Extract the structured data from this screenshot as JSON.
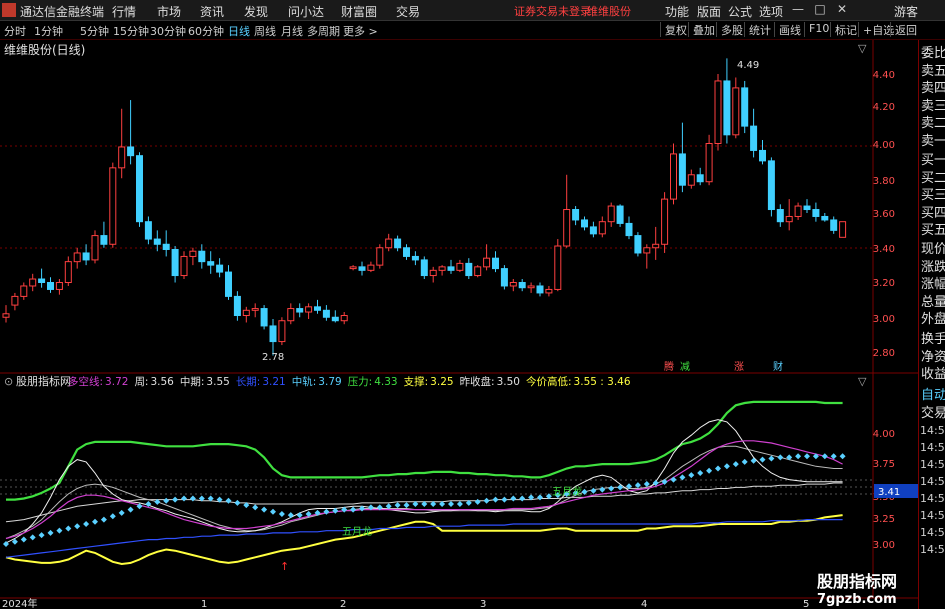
{
  "title_bar": {
    "app_name": "通达信金融终端",
    "menus": [
      "行情",
      "市场",
      "资讯",
      "发现",
      "问小达",
      "财富圈",
      "交易"
    ],
    "notice": "证券交易未登录",
    "stock_name": "维维股份",
    "right_menus": [
      "功能",
      "版面",
      "公式",
      "选项"
    ],
    "user": "游客",
    "window_controls": [
      "—",
      "□",
      "✕"
    ]
  },
  "period_bar": {
    "periods": [
      "分时",
      "1分钟",
      "5分钟",
      "15分钟",
      "30分钟",
      "60分钟",
      "日线",
      "周线",
      "月线",
      "多周期",
      "更多 >"
    ],
    "active_period": "日线",
    "tools": [
      "复权",
      "叠加",
      "多股",
      "统计",
      "画线",
      "F10",
      "标记",
      "+自选",
      "返回"
    ]
  },
  "main_chart": {
    "caption": "维维股份(日线)",
    "y_ticks": [
      "4.40",
      "4.20",
      "4.00",
      "3.80",
      "3.60",
      "3.40",
      "3.20",
      "3.00",
      "2.80"
    ],
    "high_label": "4.49",
    "low_label": "2.78",
    "markers": [
      {
        "text": "腾",
        "color": "#ff5050"
      },
      {
        "text": "减",
        "color": "#40e040"
      },
      {
        "text": "涨",
        "color": "#ff5050"
      },
      {
        "text": "财",
        "color": "#5ad0ff"
      }
    ]
  },
  "indicator": {
    "title": "股朋指标网",
    "items": [
      {
        "label": "多空线:",
        "value": "3.72",
        "color": "#d040d0"
      },
      {
        "label": "周:",
        "value": "3.56",
        "color": "#e0e0e0"
      },
      {
        "label": "中期:",
        "value": "3.55",
        "color": "#e0e0e0"
      },
      {
        "label": "长期:",
        "value": "3.21",
        "color": "#3050ff"
      },
      {
        "label": "中轨:",
        "value": "3.79",
        "color": "#5ad0ff"
      },
      {
        "label": "压力:",
        "value": "4.33",
        "color": "#40e040"
      },
      {
        "label": "支撑:",
        "value": "3.25",
        "color": "#ffff40"
      },
      {
        "label": "昨收盘:",
        "value": "3.50",
        "color": "#e0e0e0"
      },
      {
        "label": "今价高低:",
        "value": "3.55 : 3.46",
        "color": "#ffff40"
      }
    ],
    "y_ticks": [
      "4.00",
      "3.75",
      "3.50",
      "3.25",
      "3.00"
    ],
    "current_value": "3.41",
    "annotations": [
      "五月龙",
      "五月龙"
    ]
  },
  "x_axis": {
    "labels": [
      "2024年",
      "1",
      "2",
      "3",
      "4",
      "5"
    ]
  },
  "side_panel": {
    "rows": [
      "委比",
      "卖五",
      "卖四",
      "卖三",
      "卖二",
      "卖一",
      "买一",
      "买二",
      "买三",
      "买四",
      "买五",
      "现价",
      "涨跌",
      "涨幅",
      "总量",
      "外盘",
      "换手",
      "净资",
      "收益"
    ],
    "tabs": [
      "自动",
      "交易"
    ],
    "times": [
      "14:56",
      "14:56",
      "14:56",
      "14:56",
      "14:56",
      "14:56",
      "14:56",
      "14:56",
      "14:56",
      "14:56"
    ]
  },
  "watermark": {
    "line1": "股朋指标网",
    "line2": "7gpzb.com"
  },
  "colors": {
    "up": "#ff4040",
    "down": "#40d0ff",
    "pressure": "#40e040",
    "support": "#ffff40",
    "bullbear": "#d040d0",
    "long": "#3050ff",
    "midband": "#5ad0ff",
    "grid_red": "#7a0000"
  },
  "candles": [
    [
      3.0,
      3.07,
      2.97,
      3.02
    ],
    [
      3.07,
      3.14,
      3.04,
      3.12
    ],
    [
      3.12,
      3.2,
      3.1,
      3.18
    ],
    [
      3.18,
      3.25,
      3.15,
      3.22
    ],
    [
      3.22,
      3.28,
      3.17,
      3.2
    ],
    [
      3.2,
      3.23,
      3.14,
      3.16
    ],
    [
      3.16,
      3.22,
      3.13,
      3.2
    ],
    [
      3.2,
      3.35,
      3.18,
      3.32
    ],
    [
      3.32,
      3.4,
      3.28,
      3.37
    ],
    [
      3.37,
      3.42,
      3.3,
      3.33
    ],
    [
      3.33,
      3.5,
      3.31,
      3.47
    ],
    [
      3.47,
      3.55,
      3.4,
      3.42
    ],
    [
      3.42,
      3.89,
      3.4,
      3.86
    ],
    [
      3.86,
      4.2,
      3.8,
      3.98
    ],
    [
      3.98,
      4.25,
      3.88,
      3.93
    ],
    [
      3.93,
      3.95,
      3.52,
      3.55
    ],
    [
      3.55,
      3.58,
      3.42,
      3.45
    ],
    [
      3.45,
      3.5,
      3.38,
      3.42
    ],
    [
      3.42,
      3.5,
      3.35,
      3.39
    ],
    [
      3.39,
      3.41,
      3.2,
      3.24
    ],
    [
      3.24,
      3.38,
      3.22,
      3.35
    ],
    [
      3.35,
      3.4,
      3.3,
      3.38
    ],
    [
      3.38,
      3.42,
      3.28,
      3.32
    ],
    [
      3.32,
      3.38,
      3.25,
      3.3
    ],
    [
      3.3,
      3.34,
      3.23,
      3.26
    ],
    [
      3.26,
      3.3,
      3.1,
      3.12
    ],
    [
      3.12,
      3.15,
      2.98,
      3.01
    ],
    [
      3.01,
      3.06,
      2.97,
      3.04
    ],
    [
      3.04,
      3.08,
      3.0,
      3.05
    ],
    [
      3.05,
      3.07,
      2.93,
      2.95
    ],
    [
      2.95,
      2.99,
      2.78,
      2.86
    ],
    [
      2.86,
      3.0,
      2.84,
      2.98
    ],
    [
      2.98,
      3.08,
      2.96,
      3.05
    ],
    [
      3.05,
      3.08,
      3.0,
      3.03
    ],
    [
      3.03,
      3.08,
      2.99,
      3.06
    ],
    [
      3.06,
      3.1,
      3.02,
      3.04
    ],
    [
      3.04,
      3.07,
      2.98,
      3.0
    ],
    [
      3.0,
      3.04,
      2.97,
      2.98
    ],
    [
      2.98,
      3.03,
      2.96,
      3.01
    ],
    [
      3.28,
      3.3,
      3.27,
      3.29
    ],
    [
      3.29,
      3.32,
      3.24,
      3.27
    ],
    [
      3.27,
      3.32,
      3.26,
      3.3
    ],
    [
      3.3,
      3.42,
      3.28,
      3.4
    ],
    [
      3.4,
      3.48,
      3.38,
      3.45
    ],
    [
      3.45,
      3.47,
      3.38,
      3.4
    ],
    [
      3.4,
      3.42,
      3.33,
      3.35
    ],
    [
      3.35,
      3.38,
      3.3,
      3.33
    ],
    [
      3.33,
      3.35,
      3.22,
      3.24
    ],
    [
      3.24,
      3.29,
      3.2,
      3.27
    ],
    [
      3.27,
      3.3,
      3.24,
      3.29
    ],
    [
      3.29,
      3.33,
      3.25,
      3.27
    ],
    [
      3.27,
      3.33,
      3.26,
      3.31
    ],
    [
      3.31,
      3.34,
      3.22,
      3.24
    ],
    [
      3.24,
      3.3,
      3.23,
      3.29
    ],
    [
      3.29,
      3.42,
      3.27,
      3.34
    ],
    [
      3.34,
      3.38,
      3.26,
      3.28
    ],
    [
      3.28,
      3.3,
      3.16,
      3.18
    ],
    [
      3.18,
      3.22,
      3.15,
      3.2
    ],
    [
      3.2,
      3.22,
      3.15,
      3.17
    ],
    [
      3.17,
      3.2,
      3.14,
      3.18
    ],
    [
      3.18,
      3.2,
      3.12,
      3.14
    ],
    [
      3.14,
      3.18,
      3.12,
      3.16
    ],
    [
      3.16,
      3.45,
      3.15,
      3.41
    ],
    [
      3.41,
      3.82,
      3.4,
      3.62
    ],
    [
      3.62,
      3.64,
      3.53,
      3.56
    ],
    [
      3.56,
      3.58,
      3.5,
      3.52
    ],
    [
      3.52,
      3.55,
      3.46,
      3.48
    ],
    [
      3.48,
      3.58,
      3.46,
      3.55
    ],
    [
      3.55,
      3.66,
      3.52,
      3.64
    ],
    [
      3.64,
      3.65,
      3.52,
      3.54
    ],
    [
      3.54,
      3.58,
      3.45,
      3.47
    ],
    [
      3.47,
      3.49,
      3.35,
      3.37
    ],
    [
      3.37,
      3.42,
      3.28,
      3.4
    ],
    [
      3.4,
      3.52,
      3.33,
      3.42
    ],
    [
      3.42,
      3.72,
      3.37,
      3.68
    ],
    [
      3.68,
      4.0,
      3.65,
      3.94
    ],
    [
      3.94,
      4.12,
      3.72,
      3.76
    ],
    [
      3.76,
      3.85,
      3.74,
      3.82
    ],
    [
      3.82,
      3.86,
      3.76,
      3.78
    ],
    [
      3.78,
      4.05,
      3.76,
      4.0
    ],
    [
      4.0,
      4.4,
      3.96,
      4.36
    ],
    [
      4.36,
      4.49,
      4.0,
      4.05
    ],
    [
      4.05,
      4.38,
      4.03,
      4.32
    ],
    [
      4.32,
      4.36,
      4.06,
      4.1
    ],
    [
      4.1,
      4.2,
      3.92,
      3.96
    ],
    [
      3.96,
      4.02,
      3.88,
      3.9
    ],
    [
      3.9,
      3.92,
      3.58,
      3.62
    ],
    [
      3.62,
      3.65,
      3.52,
      3.55
    ],
    [
      3.55,
      3.68,
      3.5,
      3.58
    ],
    [
      3.58,
      3.66,
      3.56,
      3.64
    ],
    [
      3.64,
      3.68,
      3.6,
      3.62
    ],
    [
      3.62,
      3.66,
      3.55,
      3.58
    ],
    [
      3.58,
      3.6,
      3.55,
      3.56
    ],
    [
      3.56,
      3.58,
      3.48,
      3.5
    ],
    [
      3.46,
      3.55,
      3.46,
      3.55
    ]
  ],
  "series": {
    "pressure": [
      3.4,
      3.4,
      3.41,
      3.43,
      3.46,
      3.5,
      3.55,
      3.7,
      3.85,
      3.9,
      3.92,
      3.92,
      3.92,
      3.92,
      3.92,
      3.91,
      3.9,
      3.89,
      3.88,
      3.88,
      3.88,
      3.88,
      3.89,
      3.9,
      3.9,
      3.9,
      3.89,
      3.88,
      3.85,
      3.78,
      3.68,
      3.62,
      3.6,
      3.6,
      3.6,
      3.6,
      3.6,
      3.6,
      3.6,
      3.6,
      3.6,
      3.61,
      3.62,
      3.62,
      3.63,
      3.63,
      3.64,
      3.64,
      3.65,
      3.65,
      3.65,
      3.64,
      3.64,
      3.63,
      3.63,
      3.62,
      3.62,
      3.61,
      3.61,
      3.6,
      3.6,
      3.62,
      3.65,
      3.68,
      3.7,
      3.7,
      3.71,
      3.72,
      3.72,
      3.72,
      3.72,
      3.73,
      3.74,
      3.76,
      3.8,
      3.85,
      3.9,
      3.92,
      3.95,
      4.0,
      4.08,
      4.18,
      4.25,
      4.27,
      4.28,
      4.28,
      4.28,
      4.28,
      4.28,
      4.28,
      4.28,
      4.28,
      4.27,
      4.27,
      4.27
    ],
    "support": [
      2.88,
      2.86,
      2.85,
      2.84,
      2.83,
      2.83,
      2.84,
      2.86,
      2.9,
      2.94,
      2.92,
      2.88,
      2.84,
      2.82,
      2.83,
      2.86,
      2.9,
      2.93,
      2.95,
      2.94,
      2.92,
      2.9,
      2.88,
      2.86,
      2.84,
      2.83,
      2.84,
      2.86,
      2.88,
      2.9,
      2.92,
      2.94,
      2.95,
      2.96,
      2.98,
      3.0,
      3.02,
      3.04,
      3.05,
      3.06,
      3.08,
      3.1,
      3.12,
      3.14,
      3.16,
      3.18,
      3.2,
      3.2,
      3.18,
      3.12,
      3.12,
      3.12,
      3.12,
      3.12,
      3.12,
      3.12,
      3.12,
      3.12,
      3.12,
      3.12,
      3.12,
      3.13,
      3.14,
      3.14,
      3.12,
      3.12,
      3.12,
      3.12,
      3.12,
      3.12,
      3.12,
      3.12,
      3.14,
      3.14,
      3.15,
      3.16,
      3.16,
      3.16,
      3.16,
      3.17,
      3.18,
      3.18,
      3.18,
      3.18,
      3.18,
      3.18,
      3.18,
      3.2,
      3.2,
      3.21,
      3.21,
      3.22,
      3.24,
      3.25,
      3.26
    ],
    "long": [
      2.88,
      2.89,
      2.9,
      2.91,
      2.92,
      2.93,
      2.94,
      2.95,
      2.96,
      2.97,
      2.98,
      2.99,
      3.0,
      3.01,
      3.02,
      3.03,
      3.04,
      3.04,
      3.05,
      3.05,
      3.06,
      3.06,
      3.07,
      3.07,
      3.08,
      3.08,
      3.08,
      3.09,
      3.09,
      3.09,
      3.1,
      3.1,
      3.1,
      3.11,
      3.11,
      3.11,
      3.12,
      3.12,
      3.12,
      3.13,
      3.13,
      3.13,
      3.14,
      3.14,
      3.14,
      3.15,
      3.15,
      3.15,
      3.16,
      3.16,
      3.16,
      3.16,
      3.17,
      3.17,
      3.17,
      3.17,
      3.17,
      3.18,
      3.18,
      3.18,
      3.18,
      3.18,
      3.18,
      3.18,
      3.18,
      3.18,
      3.18,
      3.18,
      3.18,
      3.18,
      3.18,
      3.18,
      3.18,
      3.18,
      3.18,
      3.18,
      3.18,
      3.18,
      3.19,
      3.19,
      3.19,
      3.2,
      3.2,
      3.2,
      3.2,
      3.2,
      3.21,
      3.21,
      3.21,
      3.21,
      3.22,
      3.22,
      3.22,
      3.22,
      3.22
    ],
    "midband": [
      3.0,
      3.02,
      3.04,
      3.06,
      3.08,
      3.1,
      3.12,
      3.14,
      3.16,
      3.18,
      3.2,
      3.22,
      3.25,
      3.28,
      3.31,
      3.34,
      3.36,
      3.38,
      3.39,
      3.4,
      3.41,
      3.41,
      3.41,
      3.41,
      3.4,
      3.39,
      3.37,
      3.35,
      3.33,
      3.31,
      3.29,
      3.27,
      3.26,
      3.26,
      3.27,
      3.28,
      3.29,
      3.3,
      3.31,
      3.31,
      3.32,
      3.33,
      3.33,
      3.34,
      3.35,
      3.35,
      3.36,
      3.36,
      3.36,
      3.36,
      3.36,
      3.36,
      3.37,
      3.38,
      3.39,
      3.4,
      3.4,
      3.41,
      3.41,
      3.42,
      3.42,
      3.43,
      3.44,
      3.45,
      3.46,
      3.47,
      3.48,
      3.49,
      3.5,
      3.51,
      3.52,
      3.53,
      3.54,
      3.55,
      3.56,
      3.58,
      3.6,
      3.62,
      3.64,
      3.66,
      3.68,
      3.7,
      3.72,
      3.74,
      3.75,
      3.76,
      3.77,
      3.78,
      3.78,
      3.79,
      3.79,
      3.79,
      3.79,
      3.79,
      3.79
    ],
    "weekly": [
      3.01,
      3.05,
      3.1,
      3.18,
      3.28,
      3.42,
      3.58,
      3.7,
      3.76,
      3.74,
      3.64,
      3.52,
      3.45,
      3.4,
      3.38,
      3.37,
      3.35,
      3.32,
      3.3,
      3.27,
      3.25,
      3.23,
      3.2,
      3.17,
      3.14,
      3.12,
      3.11,
      3.11,
      3.12,
      3.14,
      3.17,
      3.2,
      3.24,
      3.28,
      3.31,
      3.32,
      3.32,
      3.32,
      3.33,
      3.34,
      3.34,
      3.33,
      3.32,
      3.31,
      3.3,
      3.29,
      3.28,
      3.28,
      3.29,
      3.3,
      3.3,
      3.31,
      3.31,
      3.3,
      3.3,
      3.29,
      3.3,
      3.3,
      3.3,
      3.29,
      3.29,
      3.32,
      3.38,
      3.46,
      3.52,
      3.56,
      3.6,
      3.62,
      3.6,
      3.54,
      3.48,
      3.46,
      3.48,
      3.56,
      3.68,
      3.82,
      3.92,
      3.98,
      4.05,
      4.1,
      4.12,
      4.1,
      4.02,
      3.9,
      3.78,
      3.7,
      3.64,
      3.6,
      3.58,
      3.57,
      3.56,
      3.56,
      3.56,
      3.56,
      3.56
    ],
    "middle": [
      3.05,
      3.08,
      3.12,
      3.16,
      3.22,
      3.3,
      3.38,
      3.45,
      3.5,
      3.53,
      3.54,
      3.53,
      3.51,
      3.48,
      3.45,
      3.42,
      3.4,
      3.38,
      3.35,
      3.32,
      3.29,
      3.26,
      3.23,
      3.2,
      3.17,
      3.15,
      3.13,
      3.12,
      3.12,
      3.13,
      3.15,
      3.17,
      3.2,
      3.22,
      3.24,
      3.26,
      3.28,
      3.29,
      3.3,
      3.31,
      3.32,
      3.32,
      3.32,
      3.32,
      3.32,
      3.32,
      3.31,
      3.31,
      3.3,
      3.3,
      3.3,
      3.3,
      3.3,
      3.3,
      3.3,
      3.3,
      3.31,
      3.31,
      3.31,
      3.31,
      3.32,
      3.33,
      3.36,
      3.4,
      3.44,
      3.47,
      3.49,
      3.5,
      3.51,
      3.51,
      3.5,
      3.5,
      3.51,
      3.54,
      3.58,
      3.64,
      3.7,
      3.75,
      3.8,
      3.84,
      3.87,
      3.88,
      3.88,
      3.86,
      3.84,
      3.82,
      3.8,
      3.78,
      3.76,
      3.74,
      3.72,
      3.7,
      3.69,
      3.68,
      3.68
    ],
    "bullbear": [
      3.05,
      3.07,
      3.1,
      3.14,
      3.19,
      3.25,
      3.32,
      3.38,
      3.42,
      3.44,
      3.44,
      3.43,
      3.41,
      3.39,
      3.37,
      3.35,
      3.33,
      3.31,
      3.28,
      3.25,
      3.22,
      3.2,
      3.18,
      3.16,
      3.15,
      3.14,
      3.14,
      3.14,
      3.15,
      3.16,
      3.17,
      3.19,
      3.21,
      3.23,
      3.25,
      3.27,
      3.28,
      3.29,
      3.3,
      3.3,
      3.31,
      3.31,
      3.31,
      3.31,
      3.31,
      3.31,
      3.31,
      3.31,
      3.31,
      3.31,
      3.31,
      3.31,
      3.31,
      3.31,
      3.31,
      3.31,
      3.31,
      3.32,
      3.32,
      3.32,
      3.33,
      3.34,
      3.36,
      3.38,
      3.4,
      3.42,
      3.44,
      3.45,
      3.46,
      3.47,
      3.48,
      3.49,
      3.5,
      3.52,
      3.55,
      3.6,
      3.65,
      3.7,
      3.76,
      3.82,
      3.87,
      3.9,
      3.92,
      3.93,
      3.93,
      3.92,
      3.91,
      3.89,
      3.87,
      3.85,
      3.83,
      3.81,
      3.79,
      3.76,
      3.72
    ],
    "daily": [
      3.2,
      3.21,
      3.22,
      3.24,
      3.26,
      3.28,
      3.3,
      3.32,
      3.34,
      3.35,
      3.36,
      3.37,
      3.38,
      3.39,
      3.39,
      3.4,
      3.4,
      3.4,
      3.4,
      3.4,
      3.4,
      3.4,
      3.39,
      3.39,
      3.38,
      3.38,
      3.37,
      3.37,
      3.36,
      3.36,
      3.36,
      3.36,
      3.36,
      3.36,
      3.36,
      3.36,
      3.36,
      3.36,
      3.36,
      3.36,
      3.37,
      3.37,
      3.37,
      3.37,
      3.38,
      3.38,
      3.38,
      3.38,
      3.38,
      3.38,
      3.39,
      3.39,
      3.39,
      3.39,
      3.39,
      3.4,
      3.4,
      3.4,
      3.4,
      3.4,
      3.41,
      3.41,
      3.41,
      3.42,
      3.42,
      3.42,
      3.43,
      3.43,
      3.43,
      3.44,
      3.44,
      3.45,
      3.45,
      3.46,
      3.46,
      3.47,
      3.48,
      3.48,
      3.49,
      3.49,
      3.5,
      3.5,
      3.51,
      3.51,
      3.52,
      3.52,
      3.52,
      3.53,
      3.53,
      3.53,
      3.54,
      3.54,
      3.54,
      3.55,
      3.55
    ]
  }
}
